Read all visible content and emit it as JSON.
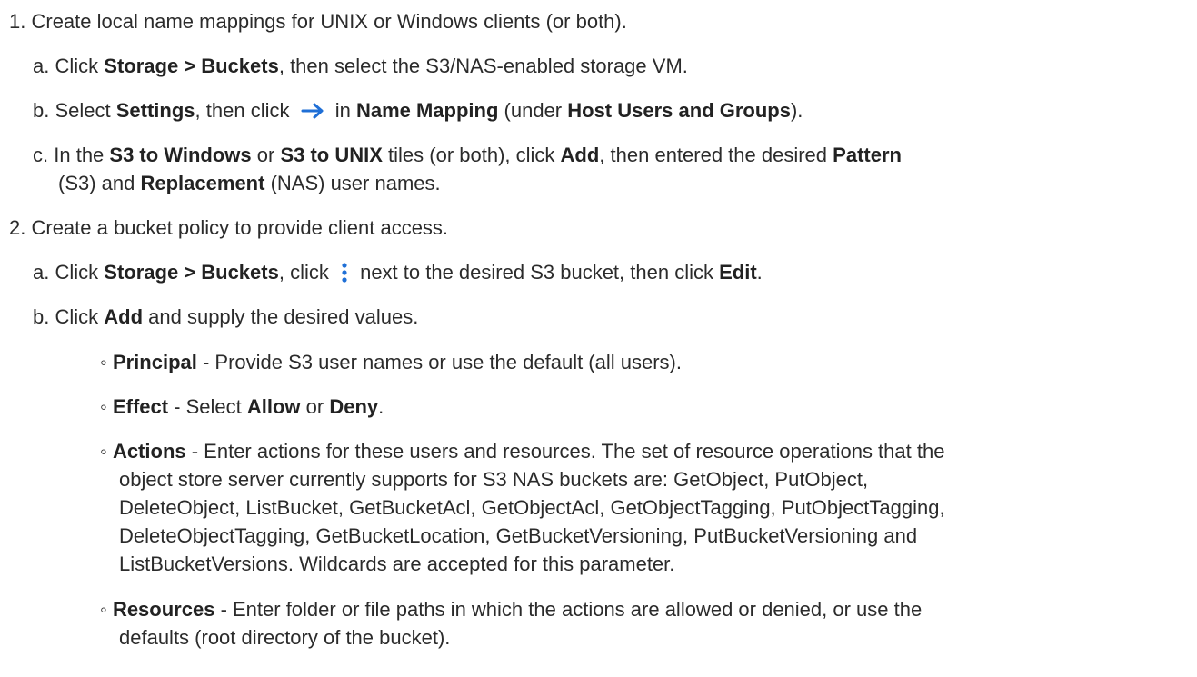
{
  "steps": [
    {
      "num": "1.",
      "text": "Create local name mappings for UNIX or Windows clients (or both).",
      "substeps": [
        {
          "letter": "a.",
          "t1": "Click ",
          "b1": "Storage > Buckets",
          "t2": ", then select the S3/NAS-enabled storage VM."
        },
        {
          "letter": "b.",
          "t1": "Select ",
          "b1": "Settings",
          "t2": ", then click ",
          "icon": "arrow-right-icon",
          "t3": " in ",
          "b2": "Name Mapping",
          "t4": " (under ",
          "b3": "Host Users and Groups",
          "t5": ")."
        },
        {
          "letter": "c.",
          "t1": "In the ",
          "b1": "S3 to Windows",
          "t2": " or ",
          "b2": "S3 to UNIX",
          "t3": " tiles (or both), click ",
          "b3": "Add",
          "t4": ", then entered the desired ",
          "b4": "Pattern",
          "l2_t1": "(S3) and ",
          "l2_b1": "Replacement",
          "l2_t2": " (NAS) user names."
        }
      ]
    },
    {
      "num": "2.",
      "text": "Create a bucket policy to provide client access.",
      "substeps": [
        {
          "letter": "a.",
          "t1": "Click ",
          "b1": "Storage > Buckets",
          "t2": ", click ",
          "icon": "kebab-menu-icon",
          "t3": " next to the desired S3 bucket, then click ",
          "b2": "Edit",
          "t4": "."
        },
        {
          "letter": "b.",
          "t1": "Click ",
          "b1": "Add",
          "t2": " and supply the desired values.",
          "bullets": [
            {
              "term": "Principal",
              "text": " - Provide S3 user names or use the default (all users)."
            },
            {
              "term": "Effect",
              "t1": " - Select ",
              "b1": "Allow",
              "t2": " or ",
              "b2": "Deny",
              "t3": "."
            },
            {
              "term": "Actions",
              "lines": [
                " - Enter actions for these users and resources. The set of resource operations that the",
                "object store server currently supports for S3 NAS buckets are: GetObject, PutObject,",
                "DeleteObject, ListBucket, GetBucketAcl, GetObjectAcl, GetObjectTagging, PutObjectTagging,",
                "DeleteObjectTagging, GetBucketLocation, GetBucketVersioning, PutBucketVersioning and",
                "ListBucketVersions. Wildcards are accepted for this parameter."
              ]
            },
            {
              "term": "Resources",
              "lines": [
                " - Enter folder or file paths in which the actions are allowed or denied, or use the",
                "defaults (root directory of the bucket)."
              ]
            }
          ]
        }
      ]
    }
  ],
  "bullet_glyph": "◦",
  "colors": {
    "text": "#2b2b2b",
    "arrow_icon": "#1f6fd6",
    "kebab_icon": "#1f6fd6"
  }
}
